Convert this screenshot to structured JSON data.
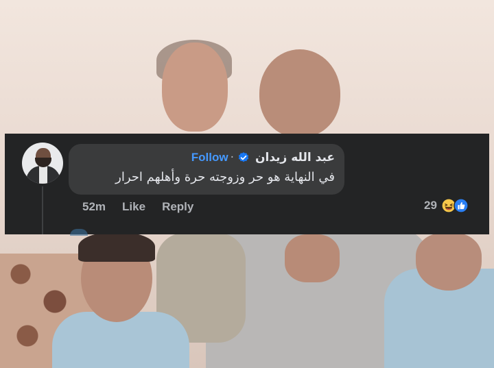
{
  "comment": {
    "author_name": "عبد الله زيدان",
    "verified_icon": "verified-badge-icon",
    "follow_label": "Follow",
    "separator": "·",
    "text": "في النهاية هو حر وزوجته حرة وأهلهم احرار",
    "timestamp": "52m",
    "like_label": "Like",
    "reply_label": "Reply",
    "reaction_count": "29",
    "reaction_icons": [
      "haha-icon",
      "like-icon"
    ]
  },
  "colors": {
    "card_bg": "#232425",
    "bubble_bg": "#3a3b3c",
    "follow_blue": "#4599ff",
    "verified_blue": "#1877f2",
    "secondary_text": "#b0b3b8",
    "primary_text": "#e4e6eb"
  }
}
